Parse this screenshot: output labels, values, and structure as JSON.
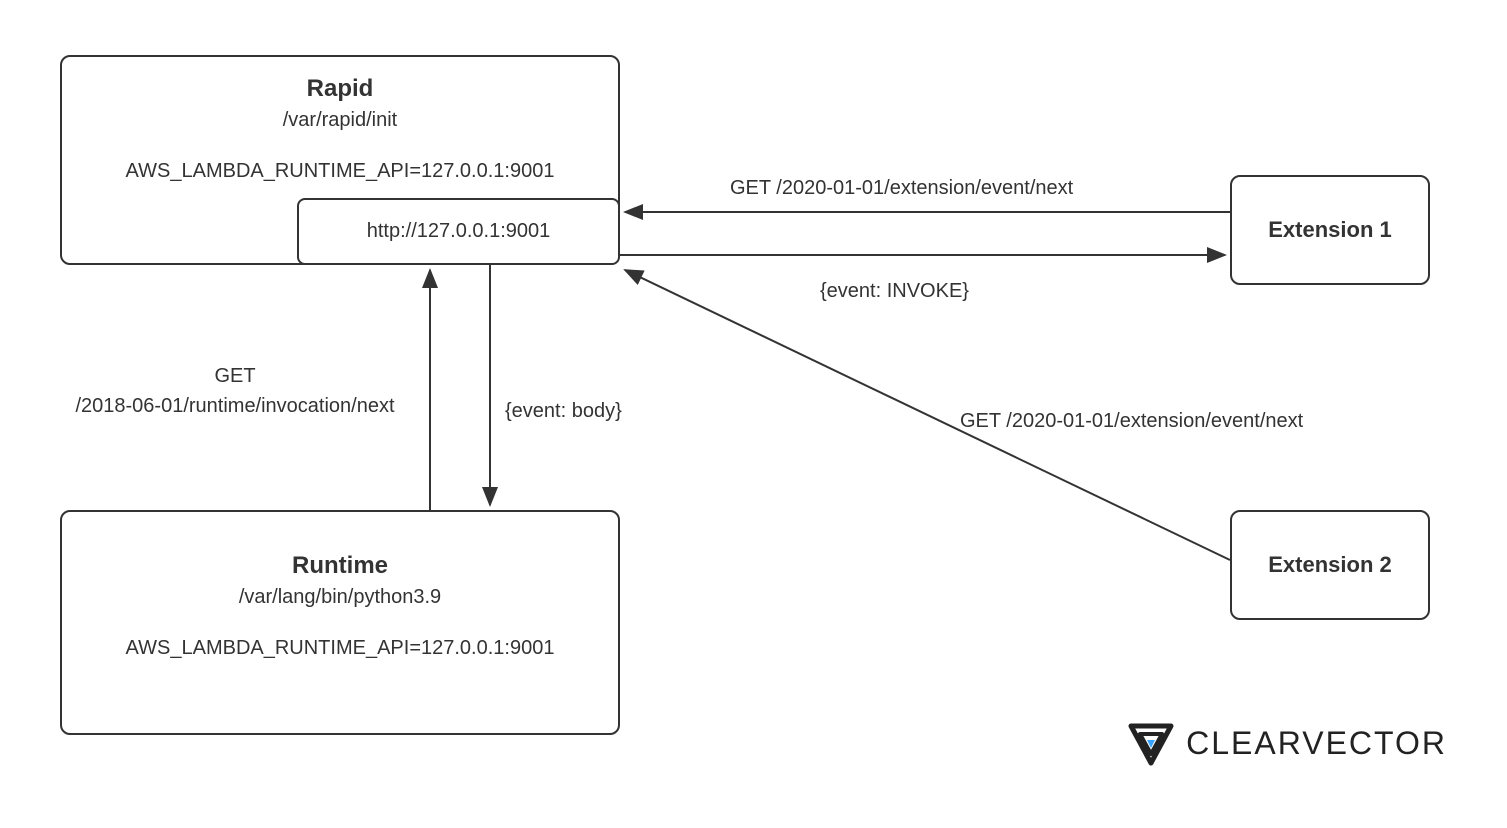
{
  "rapid": {
    "title": "Rapid",
    "path": "/var/rapid/init",
    "env": "AWS_LAMBDA_RUNTIME_API=127.0.0.1:9001",
    "http_endpoint": "http://127.0.0.1:9001"
  },
  "runtime": {
    "title": "Runtime",
    "path": "/var/lang/bin/python3.9",
    "env": "AWS_LAMBDA_RUNTIME_API=127.0.0.1:9001"
  },
  "extension1": {
    "label": "Extension 1"
  },
  "extension2": {
    "label": "Extension 2"
  },
  "arrows": {
    "runtime_to_rapid_label_line1": "GET",
    "runtime_to_rapid_label_line2": "/2018-06-01/runtime/invocation/next",
    "rapid_to_runtime_label": "{event: body}",
    "ext1_to_rapid_label": "GET /2020-01-01/extension/event/next",
    "rapid_to_ext1_label": "{event: INVOKE}",
    "ext2_to_rapid_label": "GET /2020-01-01/extension/event/next"
  },
  "logo": {
    "text": "CLEARVECTOR"
  }
}
